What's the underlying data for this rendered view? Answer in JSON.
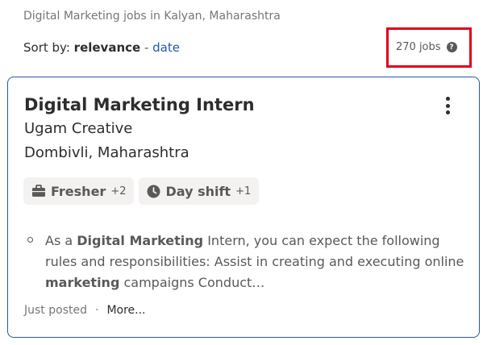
{
  "breadcrumb": "Digital Marketing jobs in Kalyan, Maharashtra",
  "sort": {
    "label": "Sort by:",
    "active": "relevance",
    "separator": " - ",
    "alt": "date"
  },
  "job_count": {
    "text": "270 jobs",
    "help_icon": "?"
  },
  "colors": {
    "accent": "#2557a7",
    "highlight_box": "#e3001b"
  },
  "job": {
    "title": "Digital Marketing Intern",
    "company": "Ugam Creative",
    "location": "Dombivli, Maharashtra",
    "tags": [
      {
        "icon": "briefcase-icon",
        "label": "Fresher",
        "extra": "+2"
      },
      {
        "icon": "clock-icon",
        "label": "Day shift",
        "extra": "+1"
      }
    ],
    "snippet": {
      "part1": "As a ",
      "bold1": "Digital Marketing",
      "part2": " Intern, you can expect the following rules and responsibilities: Assist in creating and executing online ",
      "bold2": "marketing",
      "part3": " campaigns Conduct…"
    },
    "posted": "Just posted",
    "dot": "·",
    "more": "More..."
  }
}
